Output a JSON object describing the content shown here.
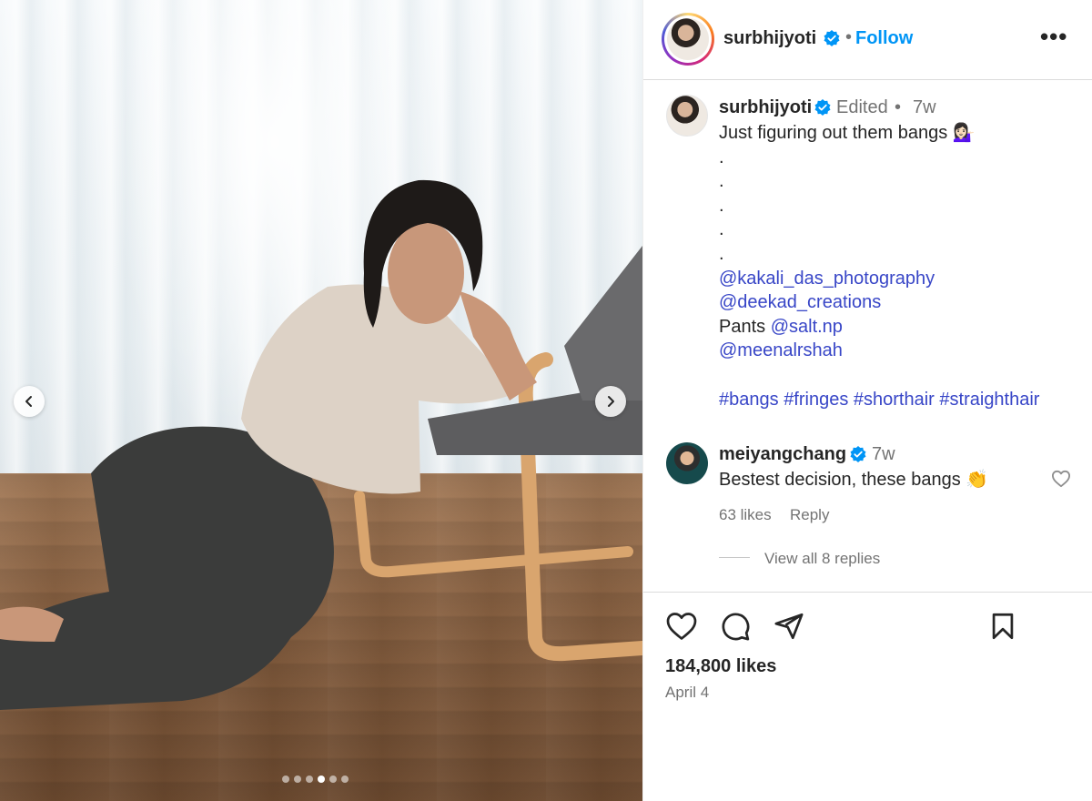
{
  "post": {
    "author": "surbhijyoti",
    "separator": "•",
    "follow_label": "Follow",
    "more_label": "•••"
  },
  "caption": {
    "author": "surbhijyoti",
    "edited_label": "Edited",
    "dot": "•",
    "time": "7w",
    "lines": [
      {
        "type": "text",
        "text": "Just figuring out them bangs 💁🏻‍♀️"
      },
      {
        "type": "text",
        "text": "."
      },
      {
        "type": "text",
        "text": "."
      },
      {
        "type": "text",
        "text": "."
      },
      {
        "type": "text",
        "text": "."
      },
      {
        "type": "text",
        "text": "."
      },
      {
        "type": "mention",
        "text": "@kakali_das_photography"
      },
      {
        "type": "mention",
        "text": "@deekad_creations"
      },
      {
        "type": "mixed",
        "prefix": "Pants ",
        "mention": "@salt.np"
      },
      {
        "type": "mention",
        "text": "@meenalrshah"
      },
      {
        "type": "blank",
        "text": ""
      },
      {
        "type": "hashtags",
        "tags": [
          "#bangs",
          "#fringes",
          "#shorthair",
          "#straighthair"
        ]
      }
    ]
  },
  "comment": {
    "author": "meiyangchang",
    "time": "7w",
    "text": "Bestest decision, these bangs 👏",
    "likes": "63 likes",
    "reply_label": "Reply",
    "view_replies": "View all 8 replies"
  },
  "footer": {
    "likes": "184,800 likes",
    "date": "April 4"
  },
  "carousel": {
    "slide_count": 6,
    "active_index": 3
  },
  "icons": {
    "verified": "verified-badge-icon",
    "prev": "chevron-left-icon",
    "next": "chevron-right-icon",
    "like": "heart-icon",
    "comment": "comment-bubble-icon",
    "share": "paper-plane-icon",
    "save": "bookmark-icon"
  },
  "colors": {
    "accent": "#0095f6",
    "link": "#3846c7",
    "verified": "#0095f6",
    "secondary_text": "#737373"
  }
}
